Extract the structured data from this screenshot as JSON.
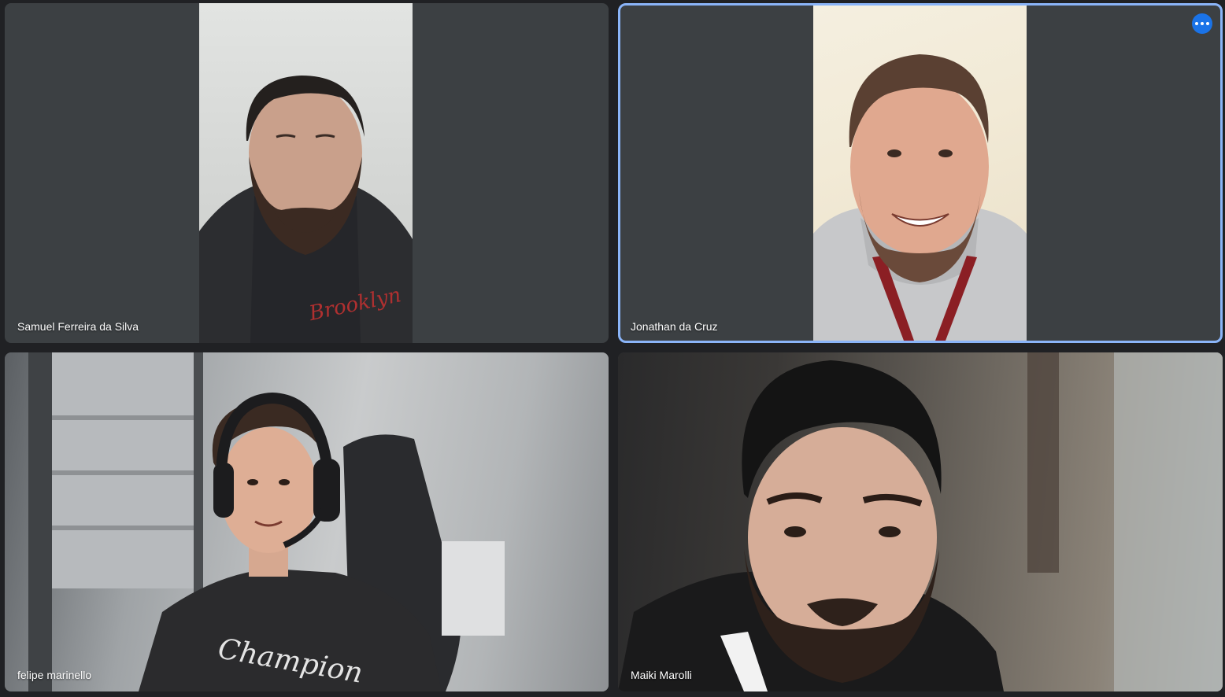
{
  "participants": [
    {
      "name": "Samuel Ferreira da Silva",
      "active_speaker": false
    },
    {
      "name": "Jonathan da Cruz",
      "active_speaker": true
    },
    {
      "name": "felipe marinello",
      "active_speaker": false
    },
    {
      "name": "Maiki Marolli",
      "active_speaker": false
    }
  ],
  "icons": {
    "more_options": "more-horiz-icon"
  },
  "colors": {
    "background": "#202124",
    "tile": "#3c4043",
    "active_border": "#8ab4f8",
    "more_button": "#1a73e8"
  },
  "shirt_texts": {
    "samuel_hoodie": "Brooklyn",
    "felipe_shirt": "Champion"
  }
}
